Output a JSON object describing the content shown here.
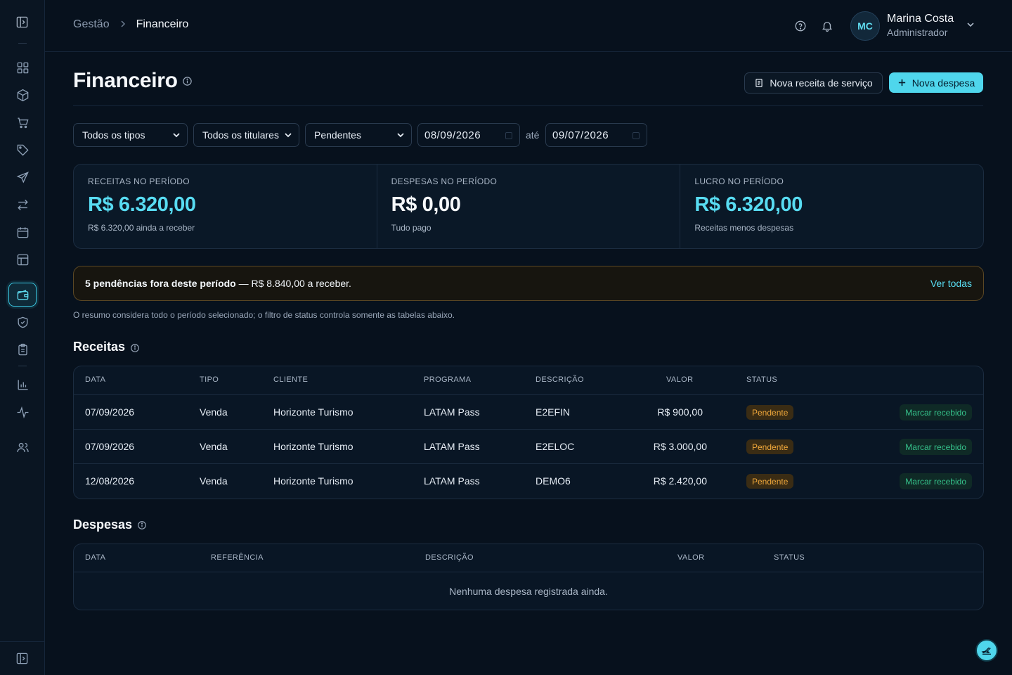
{
  "breadcrumb": {
    "parent": "Gestão",
    "current": "Financeiro"
  },
  "user": {
    "initials": "MC",
    "name": "Marina Costa",
    "role": "Administrador"
  },
  "page": {
    "title": "Financeiro",
    "btn_new_receipt": "Nova receita de serviço",
    "btn_new_expense": "Nova despesa"
  },
  "filters": {
    "type": "Todos os tipos",
    "holder": "Todos os titulares",
    "status": "Pendentes",
    "date_from": "08/09/2026",
    "date_sep": "até",
    "date_to": "09/07/2026"
  },
  "summary": {
    "income": {
      "label": "RECEITAS NO PERÍODO",
      "value": "R$ 6.320,00",
      "sub": "R$ 6.320,00 ainda a receber"
    },
    "expenses": {
      "label": "DESPESAS NO PERÍODO",
      "value": "R$ 0,00",
      "sub": "Tudo pago"
    },
    "profit": {
      "label": "LUCRO NO PERÍODO",
      "value": "R$ 6.320,00",
      "sub": "Receitas menos despesas"
    }
  },
  "alert": {
    "count_text": "5 pendências fora deste período",
    "amount_text": " — R$ 8.840,00 a receber.",
    "link": "Ver todas"
  },
  "note": "O resumo considera todo o período selecionado; o filtro de status controla somente as tabelas abaixo.",
  "receitas": {
    "title": "Receitas",
    "headers": {
      "date": "DATA",
      "type": "TIPO",
      "client": "CLIENTE",
      "program": "PROGRAMA",
      "description": "DESCRIÇÃO",
      "value": "VALOR",
      "status": "STATUS"
    },
    "rows": [
      {
        "date": "07/09/2026",
        "type": "Venda",
        "client": "Horizonte Turismo",
        "program": "LATAM Pass",
        "description": "E2EFIN",
        "value": "R$ 900,00",
        "status": "Pendente",
        "action": "Marcar recebido"
      },
      {
        "date": "07/09/2026",
        "type": "Venda",
        "client": "Horizonte Turismo",
        "program": "LATAM Pass",
        "description": "E2ELOC",
        "value": "R$ 3.000,00",
        "status": "Pendente",
        "action": "Marcar recebido"
      },
      {
        "date": "12/08/2026",
        "type": "Venda",
        "client": "Horizonte Turismo",
        "program": "LATAM Pass",
        "description": "DEMO6",
        "value": "R$ 2.420,00",
        "status": "Pendente",
        "action": "Marcar recebido"
      }
    ]
  },
  "despesas": {
    "title": "Despesas",
    "headers": {
      "date": "DATA",
      "reference": "REFERÊNCIA",
      "description": "DESCRIÇÃO",
      "value": "VALOR",
      "status": "STATUS"
    },
    "empty": "Nenhuma despesa registrada ainda."
  },
  "colors": {
    "accent": "#4fd6ec",
    "pending": "#f2a93b",
    "success": "#35c08a",
    "background": "#07111d"
  },
  "icons": {
    "sidebar": [
      "sidebar-toggle-icon",
      "dashboard-icon",
      "box-icon",
      "cart-icon",
      "tag-icon",
      "plane-icon",
      "transfer-icon",
      "calendar-icon",
      "layout-icon",
      "wallet-icon",
      "shield-icon",
      "clipboard-icon",
      "bar-chart-icon",
      "activity-icon",
      "users-icon",
      "sidebar-collapse-icon"
    ],
    "topbar": [
      "help-icon",
      "bell-icon",
      "chevron-down-icon"
    ]
  }
}
